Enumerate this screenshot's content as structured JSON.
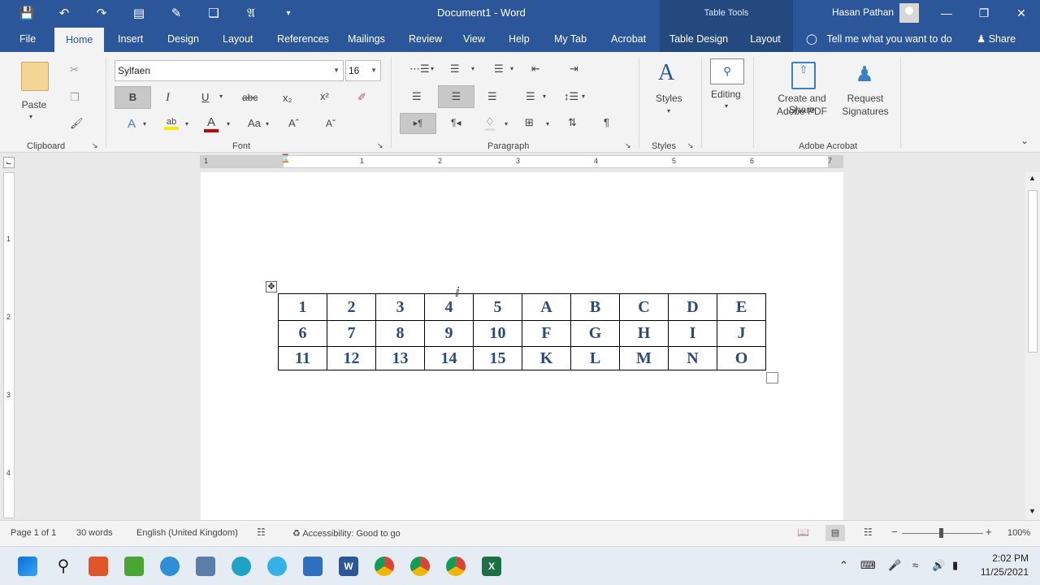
{
  "titlebar": {
    "doc_title": "Document1  -  Word",
    "table_tools": "Table Tools",
    "user_name": "Hasan Pathan"
  },
  "menu": {
    "tabs": [
      "File",
      "Home",
      "Insert",
      "Design",
      "Layout",
      "References",
      "Mailings",
      "Review",
      "View",
      "Help",
      "My Tab",
      "Acrobat",
      "Table Design",
      "Layout"
    ],
    "tell_me": "Tell me what you want to do",
    "share": "Share"
  },
  "ribbon": {
    "paste_label": "Paste",
    "font_name": "Sylfaen",
    "font_size": "16",
    "groups": {
      "clipboard": "Clipboard",
      "font": "Font",
      "paragraph": "Paragraph",
      "styles": "Styles",
      "adobe": "Adobe Acrobat"
    },
    "styles_label": "Styles",
    "editing_label": "Editing",
    "create_share": "Create and Share",
    "adobe_pdf": "Adobe PDF",
    "request": "Request",
    "signatures": "Signatures"
  },
  "ruler": {
    "h_numbers": [
      "1",
      "1",
      "2",
      "3",
      "4",
      "5",
      "6",
      "7"
    ],
    "v_numbers": [
      "1",
      "2",
      "3",
      "4"
    ]
  },
  "table": {
    "rows": [
      [
        "1",
        "2",
        "3",
        "4",
        "5",
        "A",
        "B",
        "C",
        "D",
        "E"
      ],
      [
        "6",
        "7",
        "8",
        "9",
        "10",
        "F",
        "G",
        "H",
        "I",
        "J"
      ],
      [
        "11",
        "12",
        "13",
        "14",
        "15",
        "K",
        "L",
        "M",
        "N",
        "O"
      ]
    ]
  },
  "status": {
    "page": "Page 1 of 1",
    "words": "30 words",
    "language": "English (United Kingdom)",
    "accessibility": "Accessibility: Good to go",
    "zoom": "100%"
  },
  "taskbar": {
    "time": "2:02 PM",
    "date": "11/25/2021"
  },
  "colors": {
    "title_blue": "#2b579a",
    "table_text": "#2e4a7a"
  }
}
